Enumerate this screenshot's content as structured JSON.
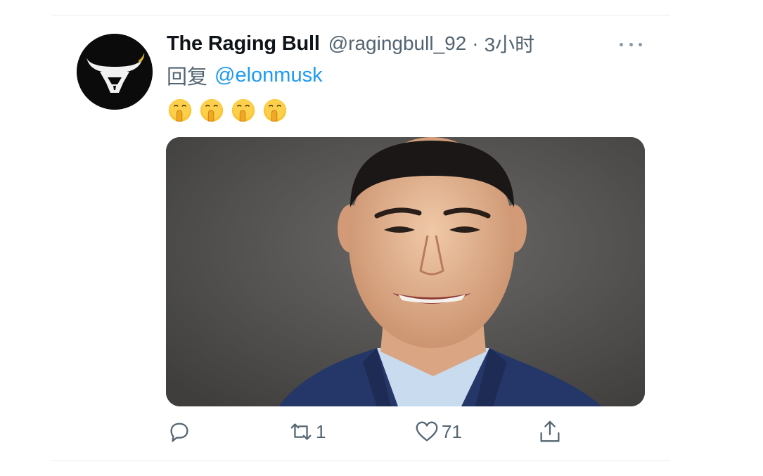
{
  "tweet": {
    "display_name": "The Raging Bull",
    "handle": "@ragingbull_92",
    "separator": "·",
    "time": "3小时",
    "reply_prefix": "回复",
    "reply_to": "@elonmusk",
    "emojis": [
      "shushing-face-emoji",
      "shushing-face-emoji",
      "shushing-face-emoji",
      "shushing-face-emoji"
    ],
    "media": {
      "type": "photo",
      "alt": ""
    },
    "actions": {
      "reply_icon": "reply-icon",
      "retweet_icon": "retweet-icon",
      "retweet_count": "1",
      "like_icon": "heart-icon",
      "like_count": "71",
      "share_icon": "share-icon"
    },
    "more_icon": "more-icon"
  },
  "colors": {
    "text": "#0f1419",
    "secondary": "#536471",
    "link": "#1d9bf0",
    "divider": "#e6ecf0",
    "avatar_bg": "#0b0b0b"
  }
}
